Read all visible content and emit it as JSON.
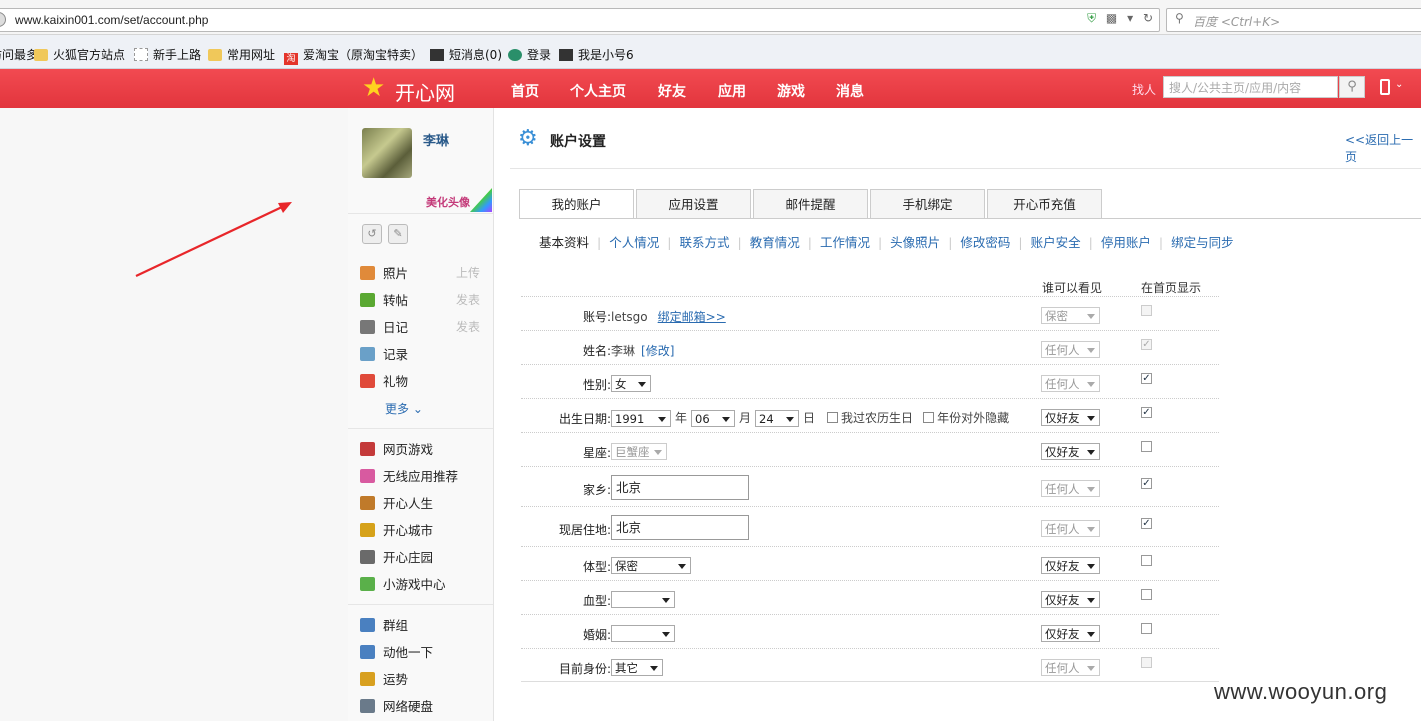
{
  "browser": {
    "url": "www.kaixin001.com/set/account.php",
    "search_placeholder": "百度 <Ctrl+K>",
    "bookmarks": [
      "访问最多",
      "火狐官方站点",
      "新手上路",
      "常用网址",
      "爱淘宝（原淘宝特卖）",
      "短消息(0)",
      "登录",
      "我是小号6"
    ]
  },
  "header": {
    "logo": "开心网",
    "nav": [
      "首页",
      "个人主页",
      "好友",
      "应用",
      "游戏",
      "消息"
    ],
    "find_label": "找人",
    "search_placeholder": "搜人/公共主页/应用/内容"
  },
  "sidebar": {
    "user_name": "李琳",
    "beautify": "美化头像",
    "items1": [
      {
        "label": "照片",
        "action": "上传",
        "icon": "photo-icon",
        "color": "#e08a3a"
      },
      {
        "label": "转帖",
        "action": "发表",
        "icon": "repost-icon",
        "color": "#5aa832"
      },
      {
        "label": "日记",
        "action": "发表",
        "icon": "diary-icon",
        "color": "#777777"
      },
      {
        "label": "记录",
        "action": "",
        "icon": "record-icon",
        "color": "#6aa0c8"
      },
      {
        "label": "礼物",
        "action": "",
        "icon": "gift-icon",
        "color": "#e04a3a"
      }
    ],
    "more": "更多",
    "items2": [
      {
        "label": "网页游戏",
        "icon": "webgame-icon",
        "color": "#c43a3a"
      },
      {
        "label": "无线应用推荐",
        "icon": "wireless-icon",
        "color": "#d85aa0"
      },
      {
        "label": "开心人生",
        "icon": "life-icon",
        "color": "#c07a2a"
      },
      {
        "label": "开心城市",
        "icon": "city-icon",
        "color": "#d6a21a"
      },
      {
        "label": "开心庄园",
        "icon": "manor-icon",
        "color": "#6a6a6a"
      },
      {
        "label": "小游戏中心",
        "icon": "minigame-icon",
        "color": "#5ab04a"
      }
    ],
    "items3": [
      {
        "label": "群组",
        "icon": "group-icon",
        "color": "#4a80c0"
      },
      {
        "label": "动他一下",
        "icon": "poke-icon",
        "color": "#4a80c0"
      },
      {
        "label": "运势",
        "icon": "fortune-icon",
        "color": "#d8a020"
      },
      {
        "label": "网络硬盘",
        "icon": "disk-icon",
        "color": "#6a7a8a"
      }
    ]
  },
  "main": {
    "title": "账户设置",
    "back": "<<返回上一页",
    "tabs": [
      "我的账户",
      "应用设置",
      "邮件提醒",
      "手机绑定",
      "开心币充值"
    ],
    "subtabs": [
      "基本资料",
      "个人情况",
      "联系方式",
      "教育情况",
      "工作情况",
      "头像照片",
      "修改密码",
      "账户安全",
      "停用账户",
      "绑定与同步"
    ],
    "col_visibility": "谁可以看见",
    "col_homepage": "在首页显示",
    "rows": [
      {
        "label": "账号:",
        "value": "letsgo",
        "link": "绑定邮箱>>",
        "visibility": "保密",
        "vis_enabled": false,
        "checked": false,
        "chk_enabled": false
      },
      {
        "label": "姓名:",
        "value": "李琳",
        "link": "[修改]",
        "visibility": "任何人",
        "vis_enabled": false,
        "checked": true,
        "chk_enabled": false
      },
      {
        "label": "性别:",
        "value": "女",
        "visibility": "任何人",
        "vis_enabled": false,
        "checked": true,
        "chk_enabled": true
      },
      {
        "label": "出生日期:",
        "year": "1991",
        "year_unit": "年",
        "month": "06",
        "month_unit": "月",
        "day": "24",
        "day_unit": "日",
        "lunar": "我过农历生日",
        "hide_year": "年份对外隐藏",
        "visibility": "仅好友",
        "vis_enabled": true,
        "checked": true,
        "chk_enabled": true
      },
      {
        "label": "星座:",
        "value": "巨蟹座",
        "visibility": "仅好友",
        "vis_enabled": true,
        "checked": false,
        "chk_enabled": true
      },
      {
        "label": "家乡:",
        "value": "北京",
        "visibility": "任何人",
        "vis_enabled": false,
        "checked": true,
        "chk_enabled": true
      },
      {
        "label": "现居住地:",
        "value": "北京",
        "visibility": "任何人",
        "vis_enabled": false,
        "checked": true,
        "chk_enabled": true
      },
      {
        "label": "体型:",
        "value": "保密",
        "visibility": "仅好友",
        "vis_enabled": true,
        "checked": false,
        "chk_enabled": true
      },
      {
        "label": "血型:",
        "value": "",
        "visibility": "仅好友",
        "vis_enabled": true,
        "checked": false,
        "chk_enabled": true
      },
      {
        "label": "婚姻:",
        "value": "",
        "visibility": "仅好友",
        "vis_enabled": true,
        "checked": false,
        "chk_enabled": true
      },
      {
        "label": "目前身份:",
        "value": "其它",
        "visibility": "任何人",
        "vis_enabled": false,
        "checked": false,
        "chk_enabled": false
      }
    ]
  },
  "watermark": "www.wooyun.org",
  "colors": {
    "header_red": "#e2353d",
    "link_blue": "#2a6bb0",
    "arrow_red": "#e8262a"
  }
}
